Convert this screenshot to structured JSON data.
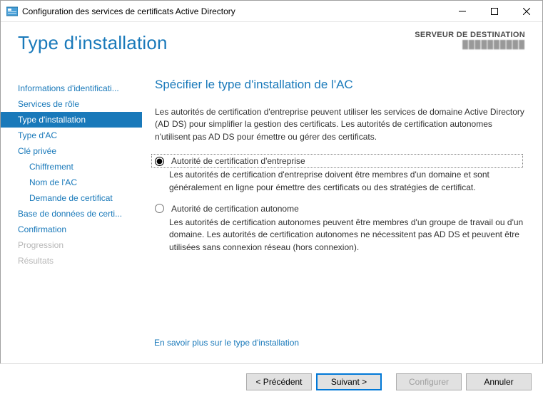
{
  "window": {
    "title": "Configuration des services de certificats Active Directory"
  },
  "header": {
    "page_title": "Type d'installation",
    "destination_label": "SERVEUR DE DESTINATION",
    "destination_server": "██████████"
  },
  "sidebar": {
    "items": [
      {
        "label": "Informations d'identificati...",
        "indent": false,
        "selected": false,
        "disabled": false
      },
      {
        "label": "Services de rôle",
        "indent": false,
        "selected": false,
        "disabled": false
      },
      {
        "label": "Type d'installation",
        "indent": false,
        "selected": true,
        "disabled": false
      },
      {
        "label": "Type d'AC",
        "indent": false,
        "selected": false,
        "disabled": false
      },
      {
        "label": "Clé privée",
        "indent": false,
        "selected": false,
        "disabled": false
      },
      {
        "label": "Chiffrement",
        "indent": true,
        "selected": false,
        "disabled": false
      },
      {
        "label": "Nom de l'AC",
        "indent": true,
        "selected": false,
        "disabled": false
      },
      {
        "label": "Demande de certificat",
        "indent": true,
        "selected": false,
        "disabled": false
      },
      {
        "label": "Base de données de certi...",
        "indent": false,
        "selected": false,
        "disabled": false
      },
      {
        "label": "Confirmation",
        "indent": false,
        "selected": false,
        "disabled": false
      },
      {
        "label": "Progression",
        "indent": false,
        "selected": false,
        "disabled": true
      },
      {
        "label": "Résultats",
        "indent": false,
        "selected": false,
        "disabled": true
      }
    ]
  },
  "content": {
    "heading": "Spécifier le type d'installation de l'AC",
    "intro": "Les autorités de certification d'entreprise peuvent utiliser les services de domaine Active Directory (AD DS) pour simplifier la gestion des certificats. Les autorités de certification autonomes n'utilisent pas AD DS pour émettre ou gérer des certificats.",
    "options": [
      {
        "label": "Autorité de certification d'entreprise",
        "desc": "Les autorités de certification d'entreprise doivent être membres d'un domaine et sont généralement en ligne pour émettre des certificats ou des stratégies de certificat.",
        "checked": true
      },
      {
        "label": "Autorité de certification autonome",
        "desc": "Les autorités de certification autonomes peuvent être membres d'un groupe de travail ou d'un domaine. Les autorités de certification autonomes ne nécessitent pas AD DS et peuvent être utilisées sans connexion réseau (hors connexion).",
        "checked": false
      }
    ],
    "learn_more": "En savoir plus sur le type d'installation"
  },
  "footer": {
    "previous": "< Précédent",
    "next": "Suivant >",
    "configure": "Configurer",
    "cancel": "Annuler"
  }
}
